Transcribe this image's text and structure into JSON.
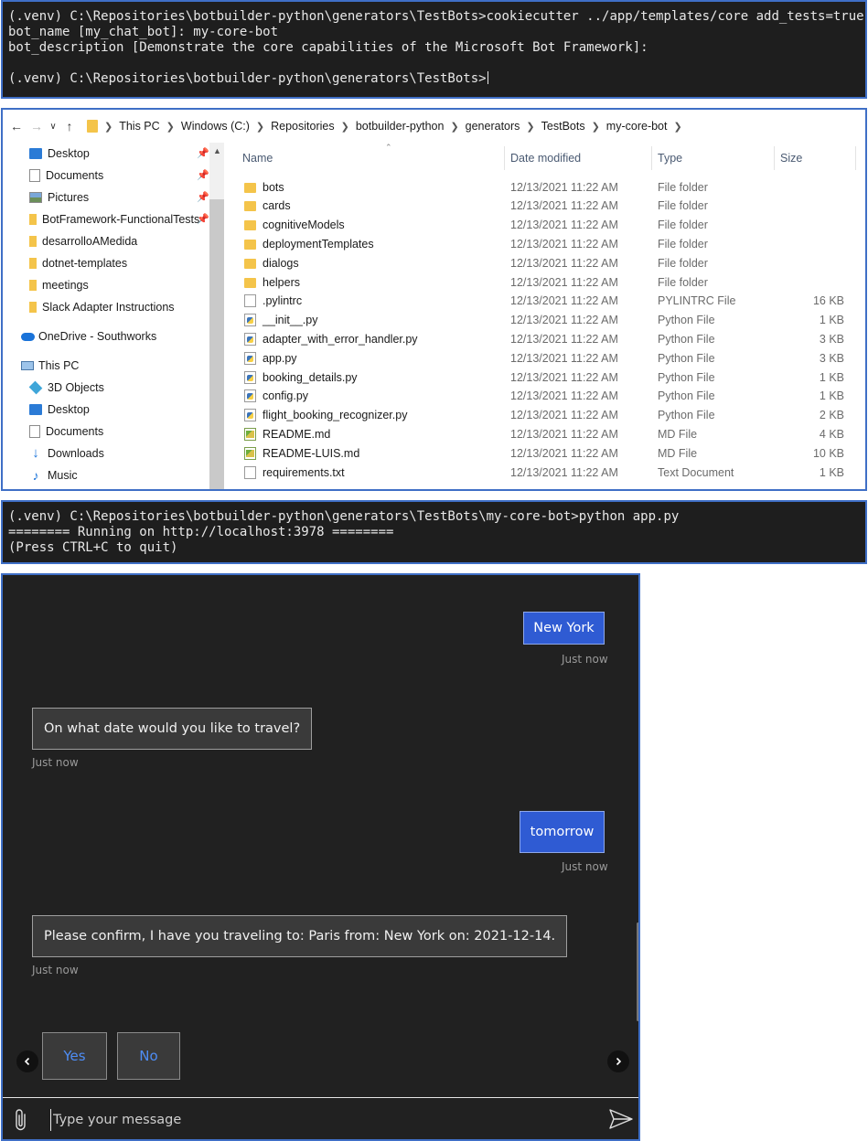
{
  "terminal1": {
    "lines": [
      "(.venv) C:\\Repositories\\botbuilder-python\\generators\\TestBots>cookiecutter ../app/templates/core add_tests=true",
      "bot_name [my_chat_bot]: my-core-bot",
      "bot_description [Demonstrate the core capabilities of the Microsoft Bot Framework]:",
      "",
      "(.venv) C:\\Repositories\\botbuilder-python\\generators\\TestBots>"
    ]
  },
  "explorer": {
    "breadcrumbs": [
      "This PC",
      "Windows (C:)",
      "Repositories",
      "botbuilder-python",
      "generators",
      "TestBots",
      "my-core-bot"
    ],
    "nav": {
      "quick_access": [
        {
          "label": "Desktop",
          "icon": "desktop-icon",
          "pinned": true
        },
        {
          "label": "Documents",
          "icon": "documents-icon",
          "pinned": true
        },
        {
          "label": "Pictures",
          "icon": "pictures-icon",
          "pinned": true
        },
        {
          "label": "BotFramework-FunctionalTests",
          "icon": "folder-icon",
          "pinned": true
        },
        {
          "label": "desarrolloAMedida",
          "icon": "folder-icon",
          "pinned": false
        },
        {
          "label": "dotnet-templates",
          "icon": "folder-icon",
          "pinned": false
        },
        {
          "label": "meetings",
          "icon": "folder-icon",
          "pinned": false
        },
        {
          "label": "Slack Adapter Instructions",
          "icon": "folder-icon",
          "pinned": false
        }
      ],
      "onedrive": "OneDrive - Southworks",
      "this_pc": "This PC",
      "this_pc_items": [
        {
          "label": "3D Objects",
          "icon": "3d-objects-icon"
        },
        {
          "label": "Desktop",
          "icon": "desktop-icon"
        },
        {
          "label": "Documents",
          "icon": "documents-icon"
        },
        {
          "label": "Downloads",
          "icon": "downloads-icon"
        },
        {
          "label": "Music",
          "icon": "music-icon"
        }
      ]
    },
    "columns": {
      "name": "Name",
      "date": "Date modified",
      "type": "Type",
      "size": "Size"
    },
    "files": [
      {
        "name": "bots",
        "date": "12/13/2021 11:22 AM",
        "type": "File folder",
        "size": "",
        "icon": "folder"
      },
      {
        "name": "cards",
        "date": "12/13/2021 11:22 AM",
        "type": "File folder",
        "size": "",
        "icon": "folder"
      },
      {
        "name": "cognitiveModels",
        "date": "12/13/2021 11:22 AM",
        "type": "File folder",
        "size": "",
        "icon": "folder"
      },
      {
        "name": "deploymentTemplates",
        "date": "12/13/2021 11:22 AM",
        "type": "File folder",
        "size": "",
        "icon": "folder"
      },
      {
        "name": "dialogs",
        "date": "12/13/2021 11:22 AM",
        "type": "File folder",
        "size": "",
        "icon": "folder"
      },
      {
        "name": "helpers",
        "date": "12/13/2021 11:22 AM",
        "type": "File folder",
        "size": "",
        "icon": "folder"
      },
      {
        "name": ".pylintrc",
        "date": "12/13/2021 11:22 AM",
        "type": "PYLINTRC File",
        "size": "16 KB",
        "icon": "file"
      },
      {
        "name": "__init__.py",
        "date": "12/13/2021 11:22 AM",
        "type": "Python File",
        "size": "1 KB",
        "icon": "py"
      },
      {
        "name": "adapter_with_error_handler.py",
        "date": "12/13/2021 11:22 AM",
        "type": "Python File",
        "size": "3 KB",
        "icon": "py"
      },
      {
        "name": "app.py",
        "date": "12/13/2021 11:22 AM",
        "type": "Python File",
        "size": "3 KB",
        "icon": "py"
      },
      {
        "name": "booking_details.py",
        "date": "12/13/2021 11:22 AM",
        "type": "Python File",
        "size": "1 KB",
        "icon": "py"
      },
      {
        "name": "config.py",
        "date": "12/13/2021 11:22 AM",
        "type": "Python File",
        "size": "1 KB",
        "icon": "py"
      },
      {
        "name": "flight_booking_recognizer.py",
        "date": "12/13/2021 11:22 AM",
        "type": "Python File",
        "size": "2 KB",
        "icon": "py"
      },
      {
        "name": "README.md",
        "date": "12/13/2021 11:22 AM",
        "type": "MD File",
        "size": "4 KB",
        "icon": "md"
      },
      {
        "name": "README-LUIS.md",
        "date": "12/13/2021 11:22 AM",
        "type": "MD File",
        "size": "10 KB",
        "icon": "md"
      },
      {
        "name": "requirements.txt",
        "date": "12/13/2021 11:22 AM",
        "type": "Text Document",
        "size": "1 KB",
        "icon": "file"
      }
    ]
  },
  "terminal2": {
    "lines": [
      "(.venv) C:\\Repositories\\botbuilder-python\\generators\\TestBots\\my-core-bot>python app.py",
      "======== Running on http://localhost:3978 ========",
      "(Press CTRL+C to quit)"
    ]
  },
  "chat": {
    "messages": [
      {
        "from": "user",
        "text": "New York",
        "time": "Just now"
      },
      {
        "from": "bot",
        "text": "On what date would you like to travel?",
        "time": "Just now"
      },
      {
        "from": "user",
        "text": "tomorrow",
        "time": "Just now"
      },
      {
        "from": "bot",
        "text": "Please confirm, I have you traveling to: Paris from: New York on: 2021-12-14.",
        "time": "Just now"
      }
    ],
    "suggested_actions": [
      "Yes",
      "No"
    ],
    "input_placeholder": "Type your message"
  }
}
